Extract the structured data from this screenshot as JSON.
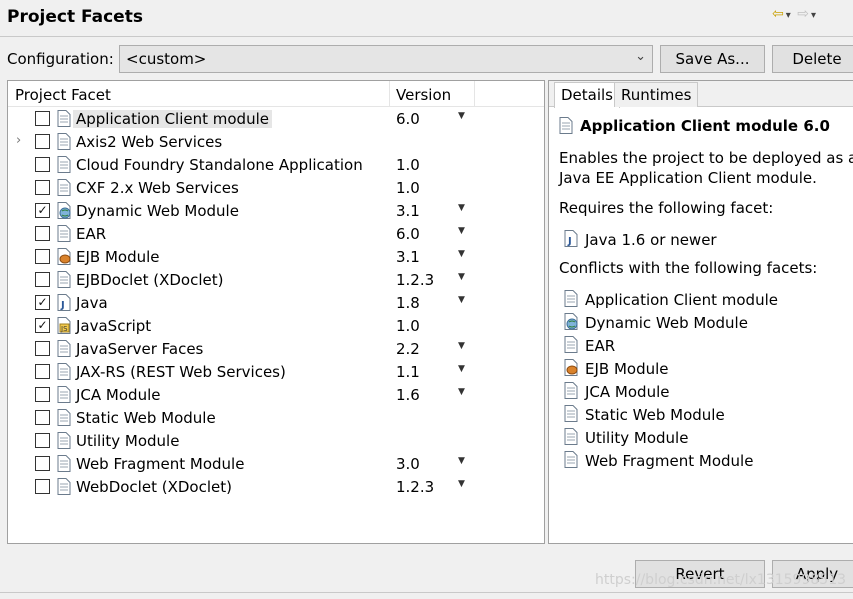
{
  "window": {
    "title": "Project Facets"
  },
  "config": {
    "label": "Configuration:",
    "value": "<custom>",
    "save_as_label": "Save As...",
    "delete_label": "Delete"
  },
  "table": {
    "col_facet": "Project Facet",
    "col_version": "Version",
    "rows": [
      {
        "name": "Application Client module",
        "version": "6.0",
        "checked": false,
        "expandable": false,
        "has_dropdown": true,
        "selected": true,
        "icon": "page-icon"
      },
      {
        "name": "Axis2 Web Services",
        "version": "",
        "checked": false,
        "expandable": true,
        "has_dropdown": false,
        "selected": false,
        "icon": "page-icon"
      },
      {
        "name": "Cloud Foundry Standalone Application",
        "version": "1.0",
        "checked": false,
        "expandable": false,
        "has_dropdown": false,
        "selected": false,
        "icon": "page-icon"
      },
      {
        "name": "CXF 2.x Web Services",
        "version": "1.0",
        "checked": false,
        "expandable": false,
        "has_dropdown": false,
        "selected": false,
        "icon": "page-icon"
      },
      {
        "name": "Dynamic Web Module",
        "version": "3.1",
        "checked": true,
        "expandable": false,
        "has_dropdown": true,
        "selected": false,
        "icon": "globe-icon"
      },
      {
        "name": "EAR",
        "version": "6.0",
        "checked": false,
        "expandable": false,
        "has_dropdown": true,
        "selected": false,
        "icon": "page-icon"
      },
      {
        "name": "EJB Module",
        "version": "3.1",
        "checked": false,
        "expandable": false,
        "has_dropdown": true,
        "selected": false,
        "icon": "bean-icon"
      },
      {
        "name": "EJBDoclet (XDoclet)",
        "version": "1.2.3",
        "checked": false,
        "expandable": false,
        "has_dropdown": true,
        "selected": false,
        "icon": "page-icon"
      },
      {
        "name": "Java",
        "version": "1.8",
        "checked": true,
        "expandable": false,
        "has_dropdown": true,
        "selected": false,
        "icon": "java-icon"
      },
      {
        "name": "JavaScript",
        "version": "1.0",
        "checked": true,
        "expandable": false,
        "has_dropdown": false,
        "selected": false,
        "icon": "javascript-icon"
      },
      {
        "name": "JavaServer Faces",
        "version": "2.2",
        "checked": false,
        "expandable": false,
        "has_dropdown": true,
        "selected": false,
        "icon": "page-icon"
      },
      {
        "name": "JAX-RS (REST Web Services)",
        "version": "1.1",
        "checked": false,
        "expandable": false,
        "has_dropdown": true,
        "selected": false,
        "icon": "page-icon"
      },
      {
        "name": "JCA Module",
        "version": "1.6",
        "checked": false,
        "expandable": false,
        "has_dropdown": true,
        "selected": false,
        "icon": "page-icon"
      },
      {
        "name": "Static Web Module",
        "version": "",
        "checked": false,
        "expandable": false,
        "has_dropdown": false,
        "selected": false,
        "icon": "page-icon"
      },
      {
        "name": "Utility Module",
        "version": "",
        "checked": false,
        "expandable": false,
        "has_dropdown": false,
        "selected": false,
        "icon": "page-icon"
      },
      {
        "name": "Web Fragment Module",
        "version": "3.0",
        "checked": false,
        "expandable": false,
        "has_dropdown": true,
        "selected": false,
        "icon": "page-icon"
      },
      {
        "name": "WebDoclet (XDoclet)",
        "version": "1.2.3",
        "checked": false,
        "expandable": false,
        "has_dropdown": true,
        "selected": false,
        "icon": "page-icon"
      }
    ]
  },
  "details": {
    "tab_details": "Details",
    "tab_runtimes": "Runtimes",
    "title": "Application Client module 6.0",
    "desc_line1": "Enables the project to be deployed as a",
    "desc_line2": "Java EE Application Client module.",
    "requires_label": "Requires the following facet:",
    "requires": [
      {
        "label": "Java 1.6 or newer",
        "icon": "java-icon"
      }
    ],
    "conflicts_label": "Conflicts with the following facets:",
    "conflicts": [
      {
        "label": "Application Client module",
        "icon": "page-icon"
      },
      {
        "label": "Dynamic Web Module",
        "icon": "globe-icon"
      },
      {
        "label": "EAR",
        "icon": "page-icon"
      },
      {
        "label": "EJB Module",
        "icon": "bean-icon"
      },
      {
        "label": "JCA Module",
        "icon": "page-icon"
      },
      {
        "label": "Static Web Module",
        "icon": "page-icon"
      },
      {
        "label": "Utility Module",
        "icon": "page-icon"
      },
      {
        "label": "Web Fragment Module",
        "icon": "page-icon"
      }
    ]
  },
  "footer": {
    "revert_label": "Revert",
    "apply_label": "Apply",
    "watermark": "https://blog.csdn.net/lx1315998513"
  },
  "icons": {
    "back": "back-arrow-icon",
    "dropdown": "chevron-down-icon",
    "forward": "forward-arrow-icon",
    "expand": "chevron-right-icon",
    "version_dropdown": "triangle-down-icon"
  },
  "colors": {
    "selection": "#e6e6e6",
    "nav_arrow": "#c9a000",
    "panel_border": "#a0a0a0",
    "background": "#f0f0f0"
  }
}
